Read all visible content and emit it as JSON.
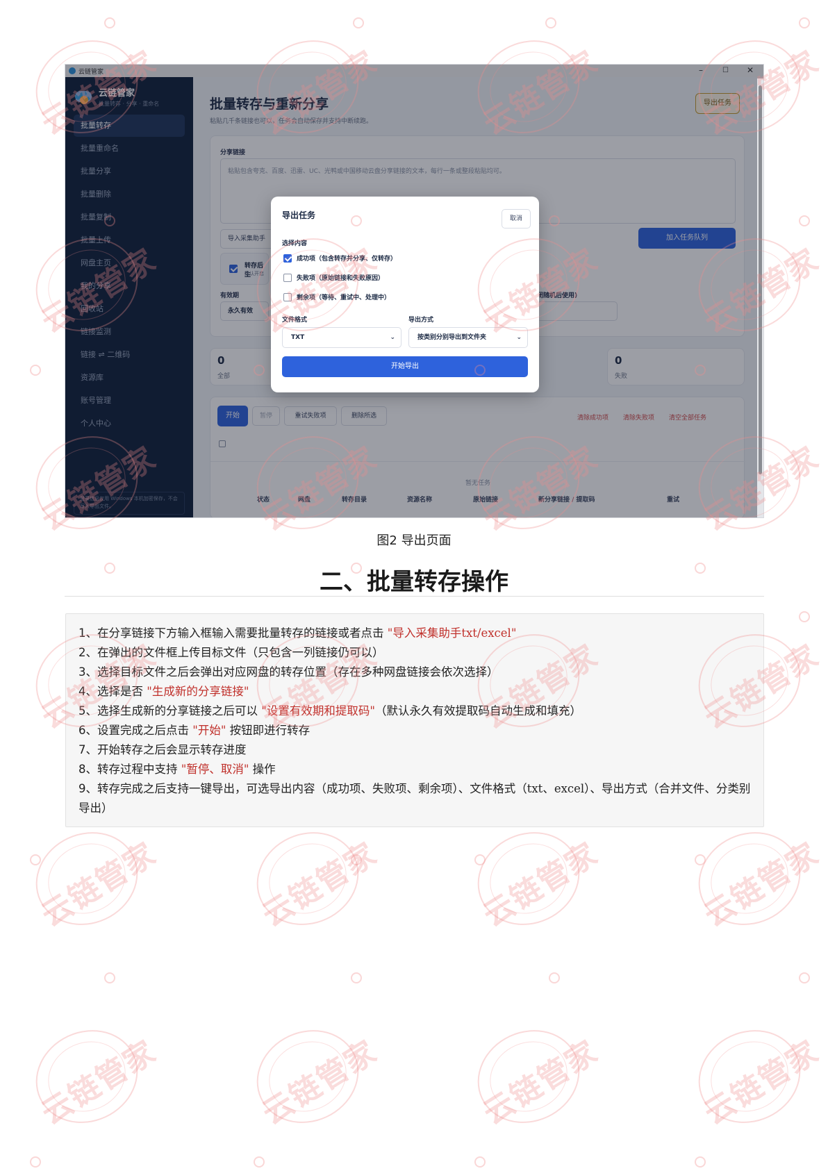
{
  "window": {
    "title": "云链管家",
    "controls": [
      "–",
      "☐",
      "✕"
    ]
  },
  "sidebar": {
    "brand": "云链管家",
    "subtitle": "批量转存 · 分享 · 重命名",
    "items": [
      {
        "label": "批量转存"
      },
      {
        "label": "批量重命名"
      },
      {
        "label": "批量分享"
      },
      {
        "label": "批量删除"
      },
      {
        "label": "批量复制"
      },
      {
        "label": "批量上传"
      },
      {
        "label": "网盘主页"
      },
      {
        "label": "我的分享"
      },
      {
        "label": "回收站"
      },
      {
        "label": "链接监测"
      },
      {
        "label": "链接 ⇌ 二维码"
      },
      {
        "label": "资源库"
      },
      {
        "label": "账号管理"
      },
      {
        "label": "个人中心"
      }
    ],
    "footer": "登录信息仅用 Windows 本机加密保存，不会写入导出文件。"
  },
  "main": {
    "title": "批量转存与重新分享",
    "subtitle": "粘贴几千条链接也可以，任务会自动保存并支持中断续跑。",
    "export_button": "导出任务",
    "share_links_label": "分享链接",
    "share_links_placeholder": "粘贴包含夸克、百度、迅雷、UC、光鸭或中国移动云盘分享链接的文本，每行一条或整段粘贴均可。",
    "import_button": "导入采集助手",
    "add_queue_button": "加入任务队列",
    "regen_label": "转存后生",
    "regen_sub": "默认开启",
    "validity_label": "有效期",
    "validity_value": "永久有效",
    "code_label": "闭随机后使用)",
    "stats": [
      {
        "value": "0",
        "label": "全部"
      },
      {
        "value": "0",
        "label": "失败"
      }
    ],
    "actions": {
      "start": "开始",
      "pause": "暂停",
      "retry": "重试失败项",
      "delete": "删除所选",
      "clear_success": "清除成功项",
      "clear_failed": "清除失败项",
      "clear_all": "清空全部任务"
    },
    "table_headers": [
      "状态",
      "网盘",
      "转存目录",
      "资源名称",
      "原始链接",
      "新分享链接 / 提取码",
      "重试"
    ],
    "empty_text": "暂无任务"
  },
  "modal": {
    "title": "导出任务",
    "cancel": "取消",
    "content_label": "选择内容",
    "options": [
      {
        "label": "成功项（包含转存并分享、仅转存）",
        "checked": true
      },
      {
        "label": "失败项（原始链接和失败原因）",
        "checked": false
      },
      {
        "label": "剩余项（等待、重试中、处理中）",
        "checked": false
      }
    ],
    "format_label": "文件格式",
    "format_value": "TXT",
    "method_label": "导出方式",
    "method_value": "按类别分别导出到文件夹",
    "start_export": "开始导出"
  },
  "document": {
    "caption": "图2 导出页面",
    "heading": "二、批量转存操作",
    "steps": [
      {
        "num": "1",
        "pre": "、在分享链接下方输入框输入需要批量转存的链接或者点击 ",
        "hl": "\"导入采集助手txt/excel\"",
        "post": ""
      },
      {
        "num": "2",
        "pre": "、在弹出的文件框上传目标文件（只包含一列链接仍可以）",
        "hl": "",
        "post": ""
      },
      {
        "num": "3",
        "pre": "、选择目标文件之后会弹出对应网盘的转存位置（存在多种网盘链接会依次选择）",
        "hl": "",
        "post": ""
      },
      {
        "num": "4",
        "pre": "、选择是否 ",
        "hl": "\"生成新的分享链接\"",
        "post": ""
      },
      {
        "num": "5",
        "pre": "、选择生成新的分享链接之后可以 ",
        "hl": "\"设置有效期和提取码\"",
        "post": "（默认永久有效提取码自动生成和填充）"
      },
      {
        "num": "6",
        "pre": "、设置完成之后点击 ",
        "hl": "\"开始\"",
        "post": " 按钮即进行转存"
      },
      {
        "num": "7",
        "pre": "、开始转存之后会显示转存进度",
        "hl": "",
        "post": ""
      },
      {
        "num": "8",
        "pre": "、转存过程中支持 ",
        "hl": "\"暂停、取消\"",
        "post": " 操作"
      },
      {
        "num": "9",
        "pre": "、转存完成之后支持一键导出，可选导出内容（成功项、失败项、剩余项）、文件格式（txt、excel）、导出方式（合并文件、分类别导出）",
        "hl": "",
        "post": ""
      }
    ],
    "watermark": "云链管家"
  }
}
